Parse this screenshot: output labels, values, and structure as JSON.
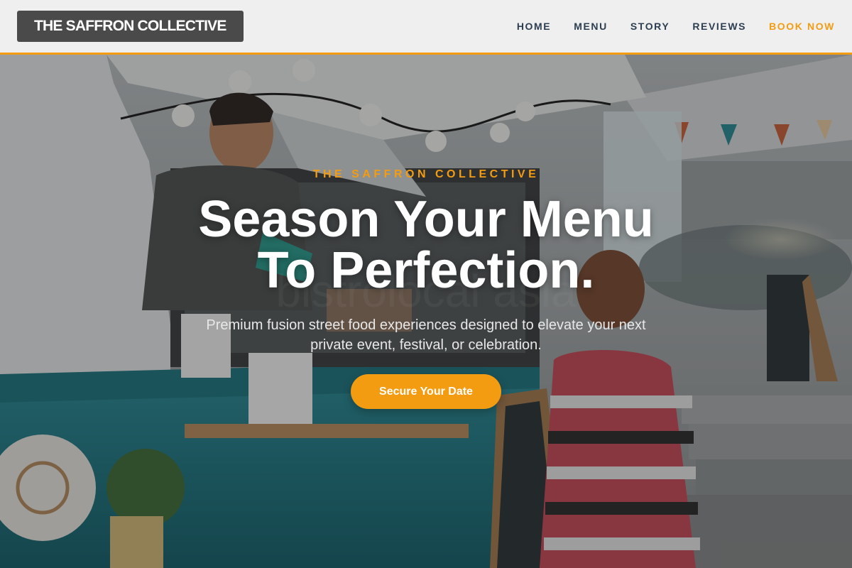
{
  "header": {
    "logo": "THE SAFFRON COLLECTIVE",
    "nav": [
      {
        "label": "HOME"
      },
      {
        "label": "MENU"
      },
      {
        "label": "STORY"
      },
      {
        "label": "REVIEWS"
      },
      {
        "label": "BOOK NOW"
      }
    ]
  },
  "hero": {
    "eyebrow": "THE SAFFRON COLLECTIVE",
    "headline_line1": "Season Your Menu",
    "headline_line2": "To Perfection.",
    "subtext": "Premium fusion street food experiences designed to elevate your next private event, festival, or celebration.",
    "cta_label": "Secure Your Date",
    "background_image": "food-truck-festival-photo"
  },
  "colors": {
    "accent": "#f39c12",
    "nav_text": "#2c3e50",
    "logo_bg": "#4a4a4a"
  }
}
